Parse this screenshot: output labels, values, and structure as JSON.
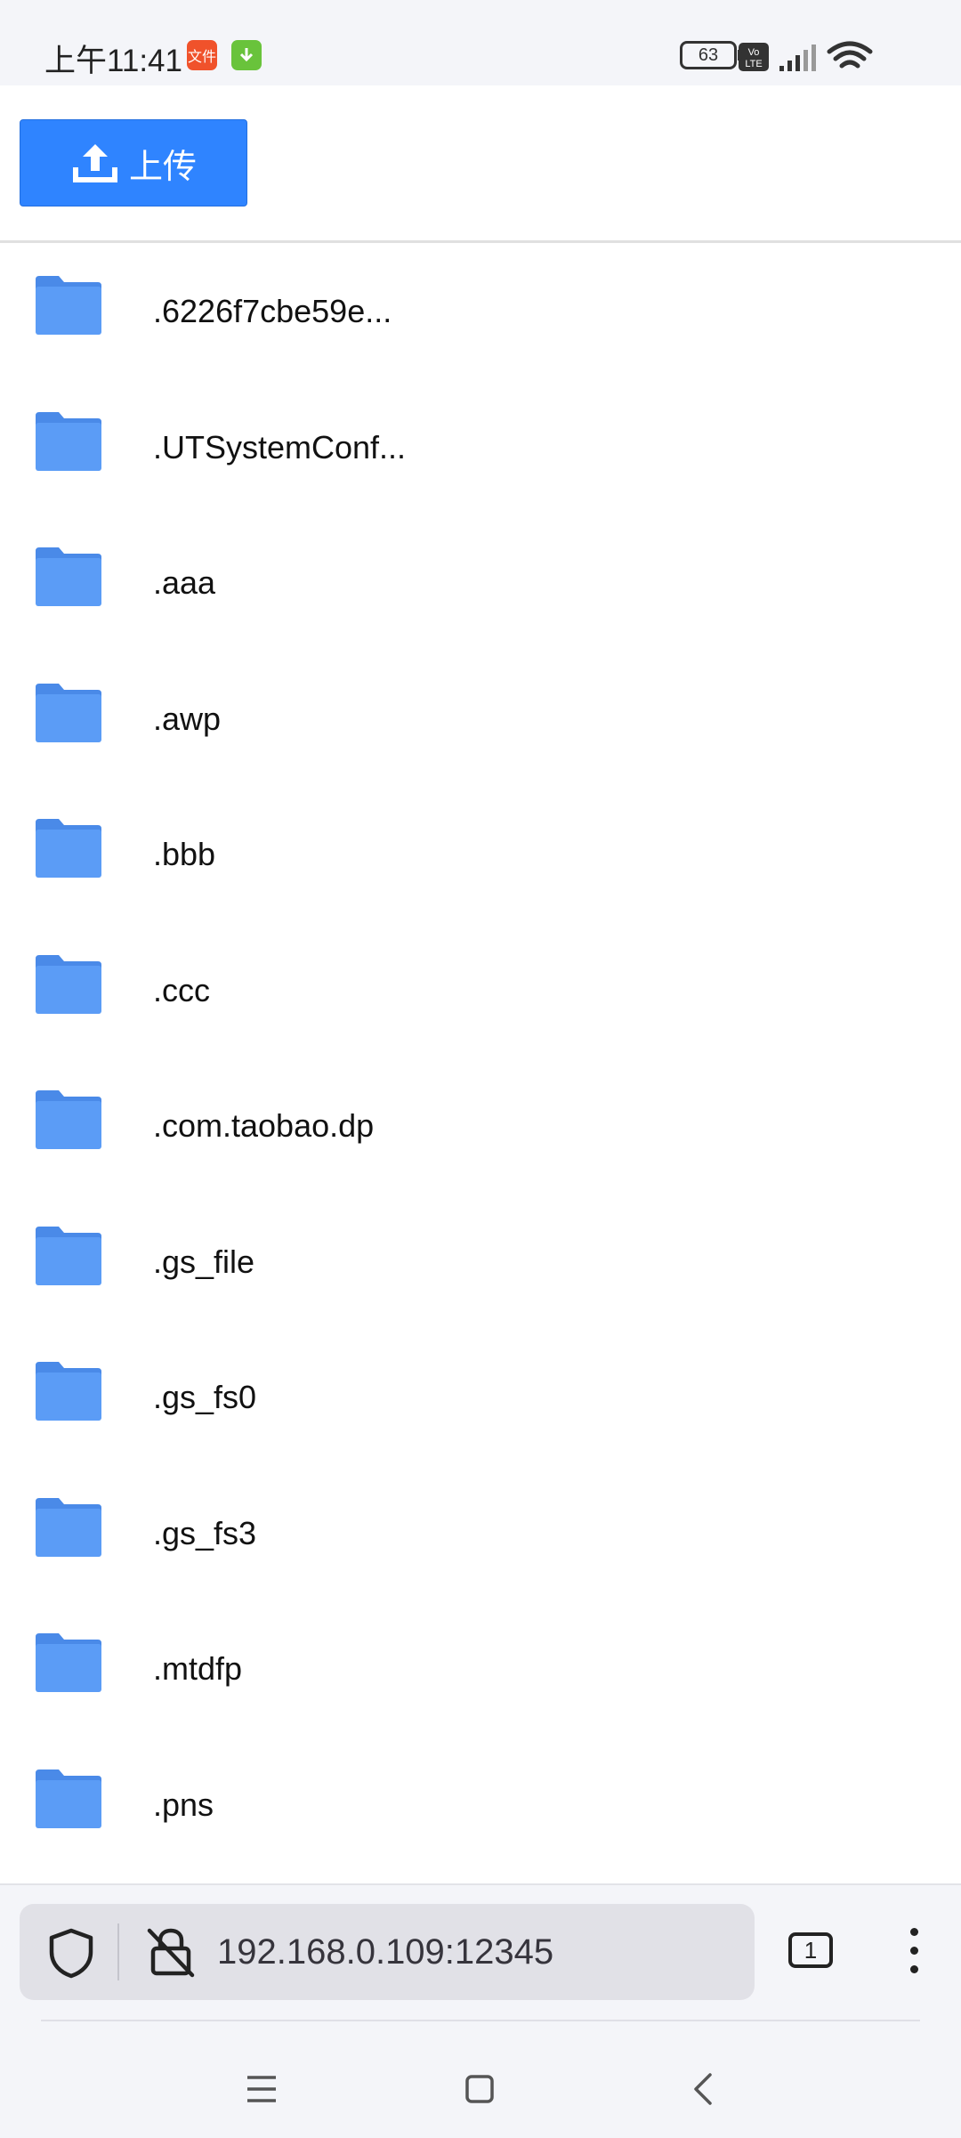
{
  "status_bar": {
    "time": "上午11:41",
    "badge_file": "文件",
    "volte": "Vo LTE",
    "battery": "63"
  },
  "toolbar": {
    "upload_label": "上传"
  },
  "files": [
    {
      "name": ".6226f7cbe59e..."
    },
    {
      "name": ".UTSystemConf..."
    },
    {
      "name": ".aaa"
    },
    {
      "name": ".awp"
    },
    {
      "name": ".bbb"
    },
    {
      "name": ".ccc"
    },
    {
      "name": ".com.taobao.dp"
    },
    {
      "name": ".gs_file"
    },
    {
      "name": ".gs_fs0"
    },
    {
      "name": ".gs_fs3"
    },
    {
      "name": ".mtdfp"
    },
    {
      "name": ".pns"
    }
  ],
  "browser": {
    "url": "192.168.0.109:12345",
    "tab_count": "1"
  },
  "colors": {
    "accent": "#2f84ff",
    "folder": "#5b9cf6",
    "folder_dark": "#4a8ae8"
  }
}
